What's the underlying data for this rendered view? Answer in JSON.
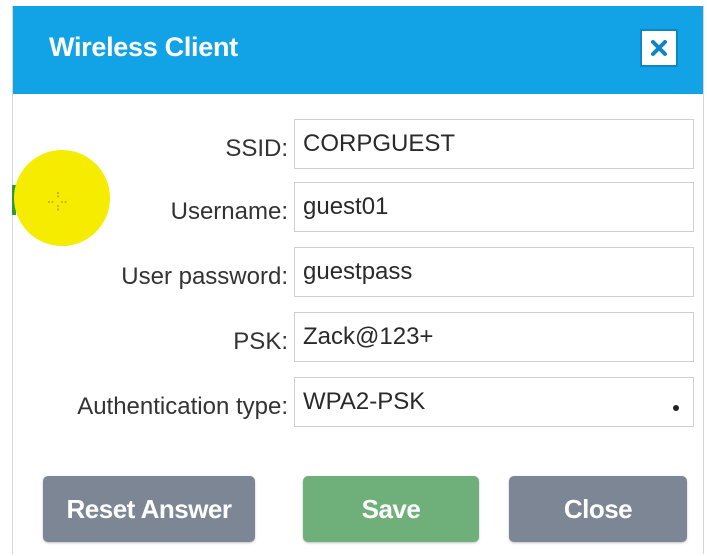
{
  "dialog": {
    "title": "Wireless Client",
    "close_icon": "close-x-icon"
  },
  "form": {
    "ssid": {
      "label": "SSID:",
      "value": "CORPGUEST"
    },
    "username": {
      "label": "Username:",
      "value": "guest01"
    },
    "user_password": {
      "label": "User password:",
      "value": "guestpass"
    },
    "psk": {
      "label": "PSK:",
      "value": "Zack@123+"
    },
    "auth_type": {
      "label": "Authentication type:",
      "value": "WPA2-PSK"
    }
  },
  "buttons": {
    "reset": "Reset Answer",
    "save": "Save",
    "close": "Close"
  },
  "colors": {
    "titlebar": "#12a3e6",
    "save_button": "#6fb07a",
    "secondary_button": "#7d8694",
    "cursor_highlight": "#f5ec00"
  }
}
